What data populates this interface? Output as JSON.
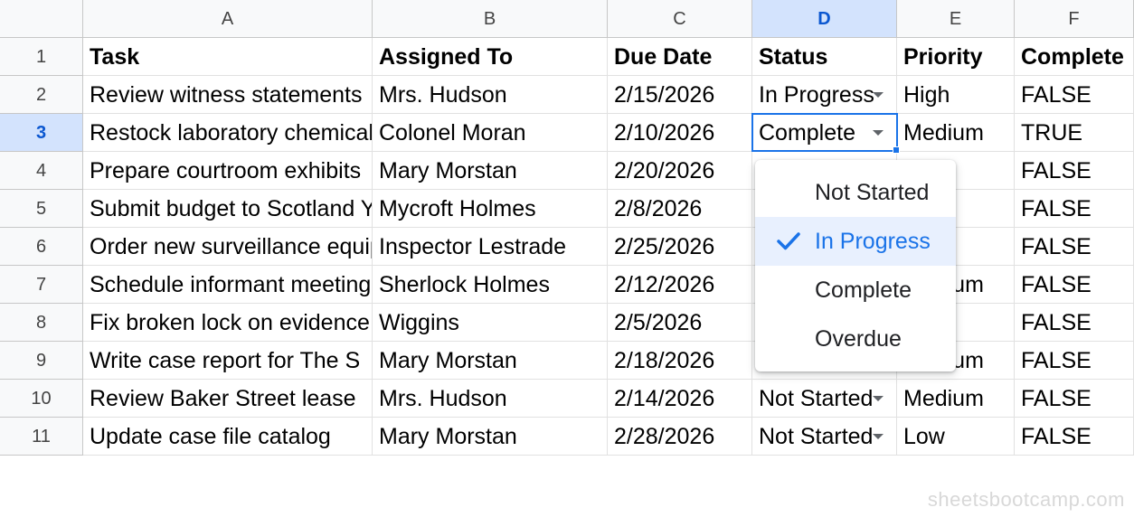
{
  "columns": [
    "A",
    "B",
    "C",
    "D",
    "E",
    "F"
  ],
  "selected_column": "D",
  "selected_row": "3",
  "rows": [
    {
      "num": "1",
      "cells": [
        "Task",
        "Assigned To",
        "Due Date",
        "Status",
        "Priority",
        "Complete"
      ]
    },
    {
      "num": "2",
      "cells": [
        "Review witness statements",
        "Mrs. Hudson",
        "2/15/2026",
        "In Progress",
        "High",
        "FALSE"
      ]
    },
    {
      "num": "3",
      "cells": [
        "Restock laboratory chemicals",
        "Colonel Moran",
        "2/10/2026",
        "Complete",
        "Medium",
        "TRUE"
      ]
    },
    {
      "num": "4",
      "cells": [
        "Prepare courtroom exhibits",
        "Mary Morstan",
        "2/20/2026",
        "",
        "",
        "FALSE"
      ]
    },
    {
      "num": "5",
      "cells": [
        "Submit budget to Scotland Yard",
        "Mycroft Holmes",
        "2/8/2026",
        "",
        "",
        "FALSE"
      ]
    },
    {
      "num": "6",
      "cells": [
        "Order new surveillance equipment",
        "Inspector Lestrade",
        "2/25/2026",
        "",
        "",
        "FALSE"
      ]
    },
    {
      "num": "7",
      "cells": [
        "Schedule informant meeting",
        "Sherlock Holmes",
        "2/12/2026",
        "",
        "Medium",
        "FALSE"
      ]
    },
    {
      "num": "8",
      "cells": [
        "Fix broken lock on evidence room",
        "Wiggins",
        "2/5/2026",
        "",
        "",
        "FALSE"
      ]
    },
    {
      "num": "9",
      "cells": [
        "Write case report for The S",
        "Mary Morstan",
        "2/18/2026",
        "",
        "Medium",
        "FALSE"
      ]
    },
    {
      "num": "10",
      "cells": [
        "Review Baker Street lease",
        "Mrs. Hudson",
        "2/14/2026",
        "Not Started",
        "Medium",
        "FALSE"
      ]
    },
    {
      "num": "11",
      "cells": [
        "Update case file catalog",
        "Mary Morstan",
        "2/28/2026",
        "Not Started",
        "Low",
        "FALSE"
      ]
    }
  ],
  "dropdown": {
    "options": [
      "Not Started",
      "In Progress",
      "Complete",
      "Overdue"
    ],
    "selected_index": 1
  },
  "watermark": "sheetsbootcamp.com",
  "colors": {
    "accent": "#1a73e8",
    "header_bg": "#f8f9fa",
    "selected_header_bg": "#d3e3fd"
  }
}
